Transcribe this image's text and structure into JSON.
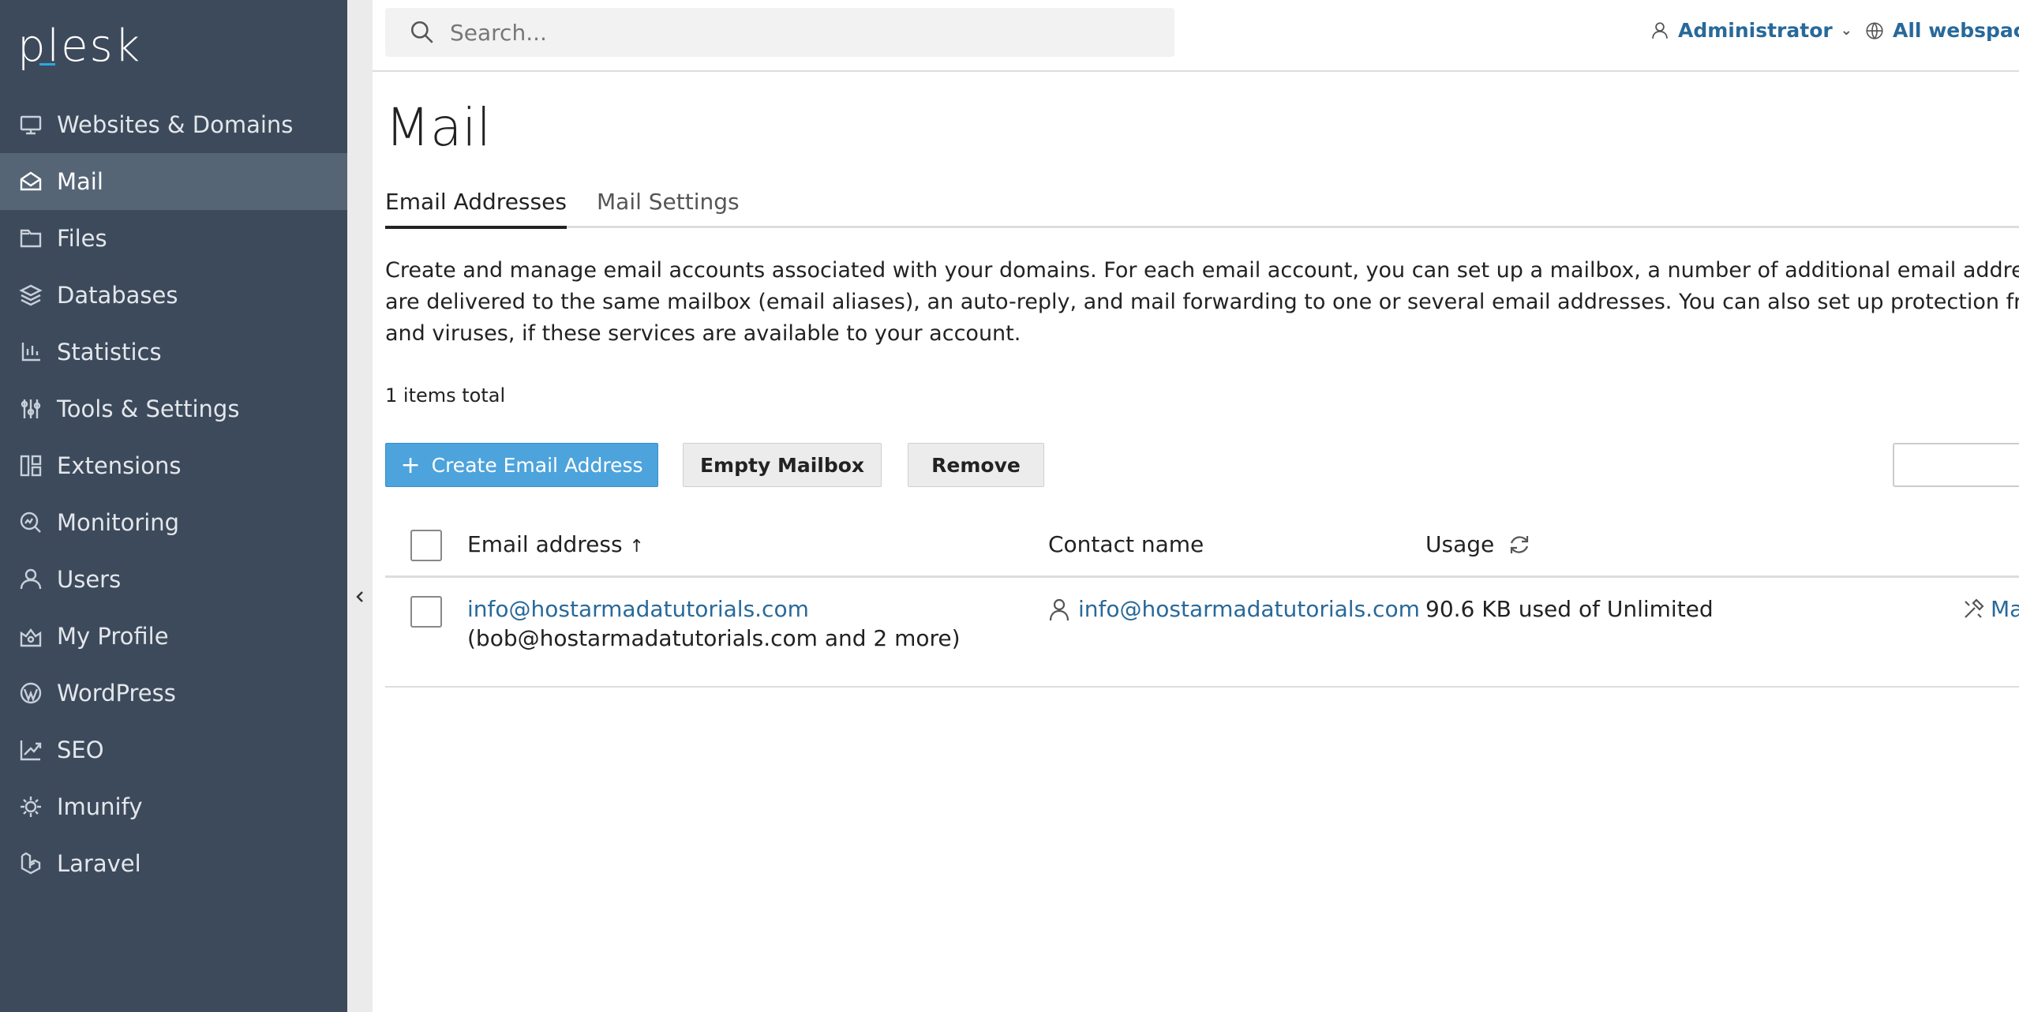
{
  "app": {
    "logo_text": "plesk"
  },
  "sidebar": {
    "items": [
      {
        "label": "Websites & Domains",
        "icon": "monitor-icon",
        "active": false
      },
      {
        "label": "Mail",
        "icon": "mail-icon",
        "active": true
      },
      {
        "label": "Files",
        "icon": "folder-icon",
        "active": false
      },
      {
        "label": "Databases",
        "icon": "layers-icon",
        "active": false
      },
      {
        "label": "Statistics",
        "icon": "bar-chart-icon",
        "active": false
      },
      {
        "label": "Tools & Settings",
        "icon": "sliders-icon",
        "active": false
      },
      {
        "label": "Extensions",
        "icon": "grid-icon",
        "active": false
      },
      {
        "label": "Monitoring",
        "icon": "magnifier-chart-icon",
        "active": false
      },
      {
        "label": "Users",
        "icon": "user-icon",
        "active": false
      },
      {
        "label": "My Profile",
        "icon": "profile-icon",
        "active": false
      },
      {
        "label": "WordPress",
        "icon": "wordpress-icon",
        "active": false
      },
      {
        "label": "SEO",
        "icon": "trend-icon",
        "active": false
      },
      {
        "label": "Imunify",
        "icon": "gear-shield-icon",
        "active": false
      },
      {
        "label": "Laravel",
        "icon": "laravel-icon",
        "active": false
      }
    ]
  },
  "header": {
    "search_placeholder": "Search...",
    "user_label": "Administrator",
    "webspaces_label": "All webspaces"
  },
  "main": {
    "title": "Mail",
    "tabs": [
      {
        "label": "Email Addresses",
        "active": true
      },
      {
        "label": "Mail Settings",
        "active": false
      }
    ],
    "description": "Create and manage email accounts associated with your domains. For each email account, you can set up a mailbox, a number of additional email addresses that are delivered to the same mailbox (email aliases), an auto-reply, and mail forwarding to one or several email addresses. You can also set up protection from spam and viruses, if these services are available to your account.",
    "items_total": "1 items total",
    "buttons": {
      "create": "Create Email Address",
      "empty": "Empty Mailbox",
      "remove": "Remove"
    },
    "table": {
      "columns": {
        "email": "Email address",
        "email_sort_indicator": "↑",
        "contact": "Contact name",
        "usage": "Usage"
      },
      "rows": [
        {
          "email": "info@hostarmadatutorials.com",
          "aliases": "(bob@hostarmadatutorials.com and 2 more)",
          "contact": "info@hostarmadatutorials.com",
          "usage": "90.6 KB used of Unlimited",
          "action": "Ma"
        }
      ]
    }
  },
  "colors": {
    "sidebar_bg": "#3d4a5b",
    "sidebar_active_bg": "#566576",
    "primary_button": "#4da3dc",
    "link": "#28699a"
  }
}
